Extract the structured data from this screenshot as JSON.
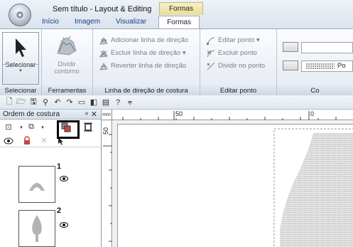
{
  "window": {
    "title": "Sem título - Layout & Editing",
    "context_tab_header": "Formas"
  },
  "tabs": [
    {
      "label": "Início"
    },
    {
      "label": "Imagem"
    },
    {
      "label": "Visualizar"
    },
    {
      "label": "Formas",
      "active": true
    }
  ],
  "ribbon": {
    "selecionar": {
      "button_label": "Selecionar",
      "group_label": "Selecionar"
    },
    "ferramentas": {
      "button_label_1": "Dividir",
      "button_label_2": "contorno",
      "group_label": "Ferramentas"
    },
    "linha_direcao": {
      "items": [
        "Adicionar linha de direção",
        "Excluir linha de direção ▾",
        "Reverter linha de direção"
      ],
      "group_label": "Linha de direção de costura"
    },
    "editar_ponto": {
      "items": [
        "Editar ponto ▾",
        "Excluir ponto",
        "Dividir no ponto"
      ],
      "group_label": "Editar ponto"
    },
    "costura": {
      "stitch_label": "Po",
      "group_label": "Co"
    }
  },
  "panel": {
    "title": "Ordem de costura",
    "pin": "ᵠ",
    "close": "✕",
    "items": [
      {
        "number": "1"
      },
      {
        "number": "2"
      }
    ]
  },
  "ruler": {
    "corner": "mm",
    "h_labels": [
      "50",
      "0"
    ],
    "v_label": "50"
  },
  "colors": {
    "accent": "#15428b",
    "ribbon_border": "#9aa8bb",
    "stitch_fill": "#d0d0d0"
  }
}
